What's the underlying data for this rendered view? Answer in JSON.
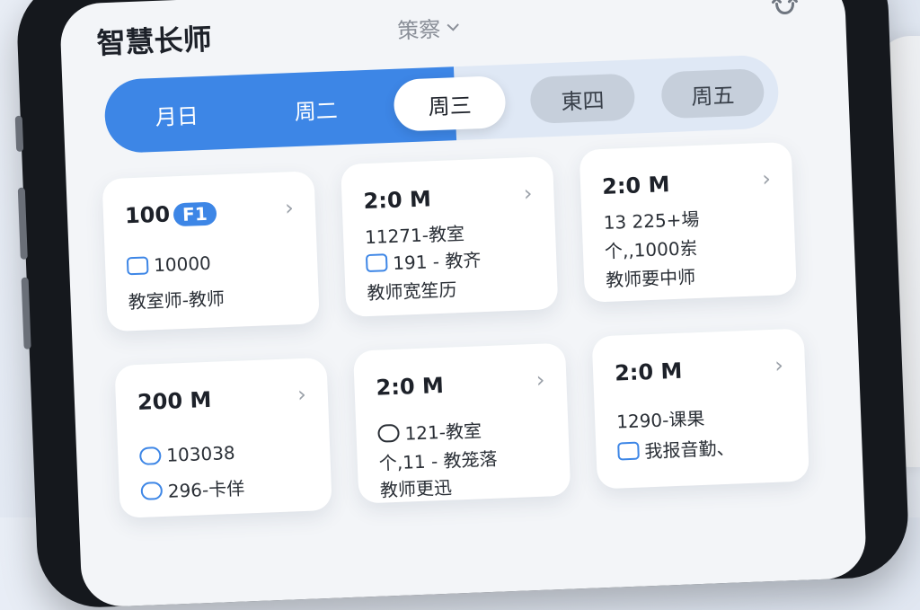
{
  "header": {
    "title": "智慧长师",
    "week_label": "策察",
    "week_icon": "chevron-down-icon",
    "refresh_icon": "refresh-icon"
  },
  "tabs": [
    {
      "label": "月日",
      "state": "selected-range"
    },
    {
      "label": "周二",
      "state": "selected-range"
    },
    {
      "label": "周三",
      "state": "active"
    },
    {
      "label": "東四",
      "state": "inactive"
    },
    {
      "label": "周五",
      "state": "inactive"
    }
  ],
  "cards": [
    {
      "time": "100",
      "badge": "F1",
      "lines": [
        "10000",
        "教室师-教师"
      ],
      "line_icons": [
        "message-icon",
        ""
      ]
    },
    {
      "time": "2:0 M",
      "badge": "",
      "lines": [
        "11271-教室",
        "191 - 教齐",
        "教师宽笙历"
      ],
      "line_icons": [
        "",
        "room-icon",
        ""
      ]
    },
    {
      "time": "2:0 M",
      "badge": "",
      "lines": [
        "13 225+場",
        "个,,1000岽",
        "教师要中师"
      ],
      "line_icons": [
        "",
        "",
        ""
      ]
    },
    {
      "time": "200 M",
      "badge": "",
      "lines": [
        "103038",
        "296-卡佯"
      ],
      "line_icons": [
        "person-icon",
        "user-icon"
      ]
    },
    {
      "time": "2:0 M",
      "badge": "",
      "lines": [
        "121-教室",
        "个,11 - 教笼落",
        "教师更迅"
      ],
      "line_icons": [
        "user-icon",
        "",
        ""
      ]
    },
    {
      "time": "2:0 M",
      "badge": "",
      "lines": [
        "1290-课果",
        "我报音勤、"
      ],
      "line_icons": [
        "",
        "book-icon"
      ]
    }
  ],
  "colors": {
    "accent": "#3d86e6",
    "background": "#f3f5f8",
    "text": "#1d2129"
  }
}
